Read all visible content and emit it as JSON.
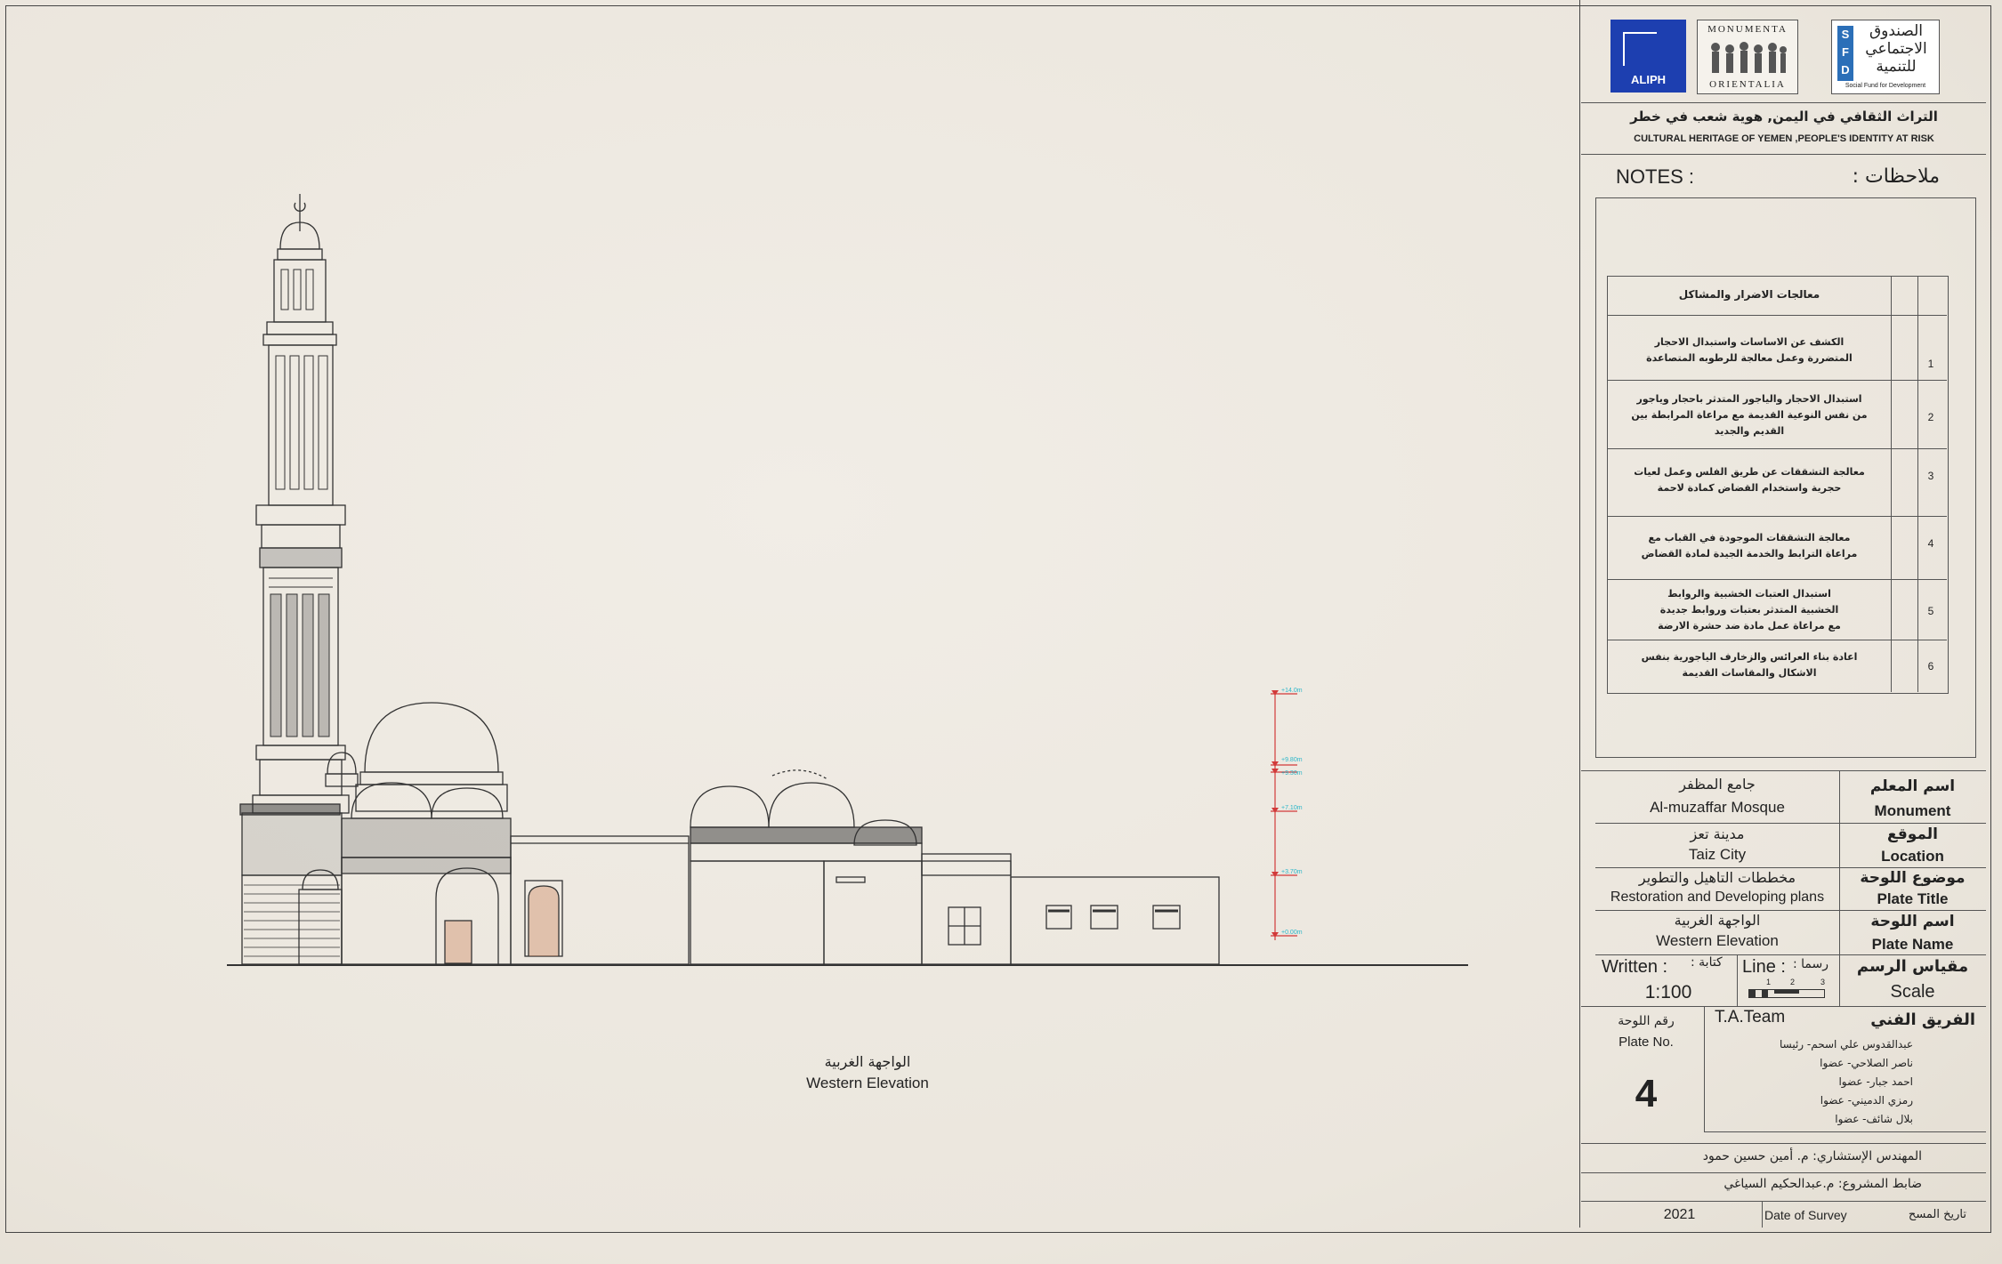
{
  "logos": {
    "aliph": "ALIPH",
    "monumenta_line1": "MONUMENTA",
    "monumenta_line2": "ORIENTALIA",
    "sfd_ar_line1": "الصندوق",
    "sfd_ar_line2": "الاجتماعي",
    "sfd_ar_line3": "للتنمية",
    "sfd_letters": [
      "S",
      "F",
      "D"
    ],
    "sfd_en": "Social Fund for Development"
  },
  "project": {
    "title_ar": "التراث الثقافي في اليمن, هوية شعب في خطر",
    "title_en": "CULTURAL HERITAGE OF YEMEN ,PEOPLE'S IDENTITY AT RISK"
  },
  "notes": {
    "label_en": "NOTES :",
    "label_ar": "ملاحظات :",
    "table_header": "معالجات الاضرار والمشاكل",
    "rows": [
      {
        "num": "1",
        "lines": [
          "الكشف عن الاساسات واستبدال الاحجار",
          "المتضررة وعمل معالجة للرطوبه المتصاعدة"
        ]
      },
      {
        "num": "2",
        "lines": [
          "استبدال الاحجار والياجور المتدثر باحجار وياجور",
          "من نفس النوعية القديمة مع مراعاة المرابطة بين",
          "القديم والجديد"
        ]
      },
      {
        "num": "3",
        "lines": [
          "معالجة التشققات عن طريق الفلس وعمل لعيات",
          "حجرية واستخدام القضاض كمادة لاحمة"
        ]
      },
      {
        "num": "4",
        "lines": [
          "معالجة التشققات الموجودة في القباب مع",
          "مراعاة الترابط والخدمة الجيدة لمادة القضاض"
        ]
      },
      {
        "num": "5",
        "lines": [
          "استبدال العتبات الخشبية والروابط",
          "الخشبية المتدثر بعتبات وروابط جديدة",
          "مع مراعاة عمل مادة ضد حشرة الارضة"
        ]
      },
      {
        "num": "6",
        "lines": [
          "اعادة بناء العرائس والزخارف الياجورية بنفس",
          "الاشكال والمقاسات القديمة"
        ]
      }
    ]
  },
  "info": {
    "monument": {
      "label_ar": "اسم المعلم",
      "label_en": "Monument",
      "value_ar": "جامع المظفر",
      "value_en": "Al-muzaffar Mosque"
    },
    "location": {
      "label_ar": "الموقع",
      "label_en": "Location",
      "value_ar": "مدينة تعز",
      "value_en": "Taiz City"
    },
    "plate_title": {
      "label_ar": "موضوع اللوحة",
      "label_en": "Plate Title",
      "value_ar": "مخططات التاهيل والتطوير",
      "value_en": "Restoration and Developing plans"
    },
    "plate_name": {
      "label_ar": "اسم اللوحة",
      "label_en": "Plate Name",
      "value_ar": "الواجهة الغربية",
      "value_en": "Western Elevation"
    },
    "scale": {
      "label_ar": "مقياس الرسم",
      "label_en": "Scale",
      "written_en": "Written :",
      "written_ar": "كتابة :",
      "written_value": "1:100",
      "line_en": "Line :",
      "line_ar": "رسما :",
      "bar_ticks": [
        "1",
        "2",
        "3"
      ]
    }
  },
  "plate_no": {
    "label_ar": "رقم اللوحة",
    "label_en": "Plate No.",
    "value": "4"
  },
  "team": {
    "label_en": "T.A.Team",
    "label_ar": "الفريق الفني",
    "members": [
      "عبدالقدوس علي اسحم- رئيسا",
      "ناصر الصلاحي- عضوا",
      "احمد جبار- عضوا",
      "رمزي الدميني- عضوا",
      "بلال شائف- عضوا"
    ]
  },
  "consultant": "المهندس الإستشاري: م. أمين حسين حمود",
  "project_officer": "ضابط المشروع: م.عبدالحكيم السياغي",
  "survey": {
    "year": "2021",
    "label_en": "Date of Survey",
    "label_ar": "تاريخ المسح"
  },
  "drawing": {
    "caption_ar": "الواجهة الغربية",
    "caption_en": "Western Elevation",
    "levels": [
      "+14.0m",
      "+9.80m",
      "+9.30m",
      "+7.10m",
      "+3.70m",
      "+0.00m"
    ]
  },
  "colors": {
    "paper": "#ede8df",
    "line": "#333333",
    "aliph_blue": "#1d3fb0",
    "sfd_blue": "#2b6fb8",
    "level_cyan": "#2bb6c9",
    "level_red": "#d23a3a",
    "door_orange": "#c8794a"
  }
}
